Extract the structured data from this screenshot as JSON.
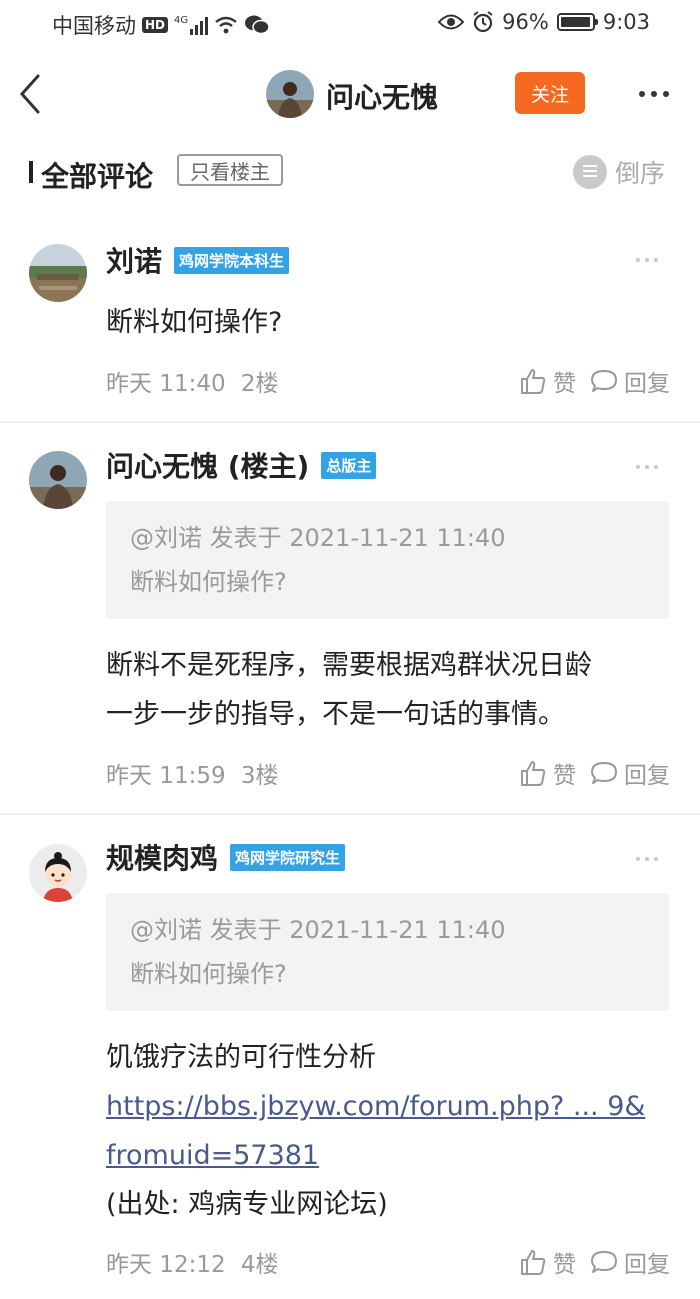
{
  "status_bar": {
    "carrier": "中国移动",
    "hd": "HD",
    "network": "4G",
    "battery": "96%",
    "battery_level": 0.96,
    "time": "9:03"
  },
  "nav": {
    "title": "问心无愧",
    "follow_label": "关注"
  },
  "section": {
    "title": "全部评论",
    "filter_label": "只看楼主",
    "sort_label": "倒序"
  },
  "comments": [
    {
      "author": "刘诺",
      "badge": "鸡网学院本科生",
      "text": "断料如何操作?",
      "time": "昨天 11:40",
      "floor": "2楼",
      "like_label": "赞",
      "reply_label": "回复"
    },
    {
      "author": "问心无愧 (楼主)",
      "badge": "总版主",
      "quote_header": "@刘诺 发表于 2021-11-21 11:40",
      "quote_text": "断料如何操作?",
      "text_line1": "断料不是死程序，需要根据鸡群状况日龄",
      "text_line2": "一步一步的指导，不是一句话的事情。",
      "time": "昨天 11:59",
      "floor": "3楼",
      "like_label": "赞",
      "reply_label": "回复"
    },
    {
      "author": "规模肉鸡",
      "badge": "鸡网学院研究生",
      "quote_header": "@刘诺 发表于 2021-11-21 11:40",
      "quote_text": "断料如何操作?",
      "text_line1": "饥饿疗法的可行性分析",
      "link_line1": "https://bbs.jbzyw.com/forum.php? ... 9&",
      "link_line2": "fromuid=57381",
      "source_text": "(出处: 鸡病专业网论坛)",
      "time": "昨天 12:12",
      "floor": "4楼",
      "like_label": "赞",
      "reply_label": "回复"
    }
  ],
  "colors": {
    "follow_button": "#f4681f",
    "badge": "#33a3e6",
    "link": "#4a5a8a"
  }
}
